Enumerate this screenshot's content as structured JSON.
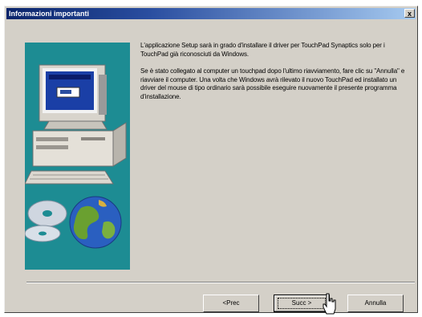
{
  "window": {
    "title": "Informazioni importanti",
    "close_label": "x"
  },
  "message": {
    "paragraph1": "L'applicazione Setup sarà in grado d'installare il driver per TouchPad Synaptics solo per i TouchPad già riconosciuti da Windows.",
    "paragraph2": "Se è stato collegato al computer un touchpad dopo l'ultimo riavviamento, fare clic su \"Annulla\" e riavviare il computer. Una volta che Windows avrà rilevato il nuovo TouchPad ed installato un driver del mouse di tipo ordinario sarà possibile eseguire nuovamente il presente programma d'installazione."
  },
  "buttons": {
    "prev": "<Prec",
    "next": "Succ >",
    "cancel": "Annulla"
  },
  "colors": {
    "panel": "#1d8c93",
    "titlebar_start": "#0a246a",
    "titlebar_end": "#a6caf0"
  }
}
